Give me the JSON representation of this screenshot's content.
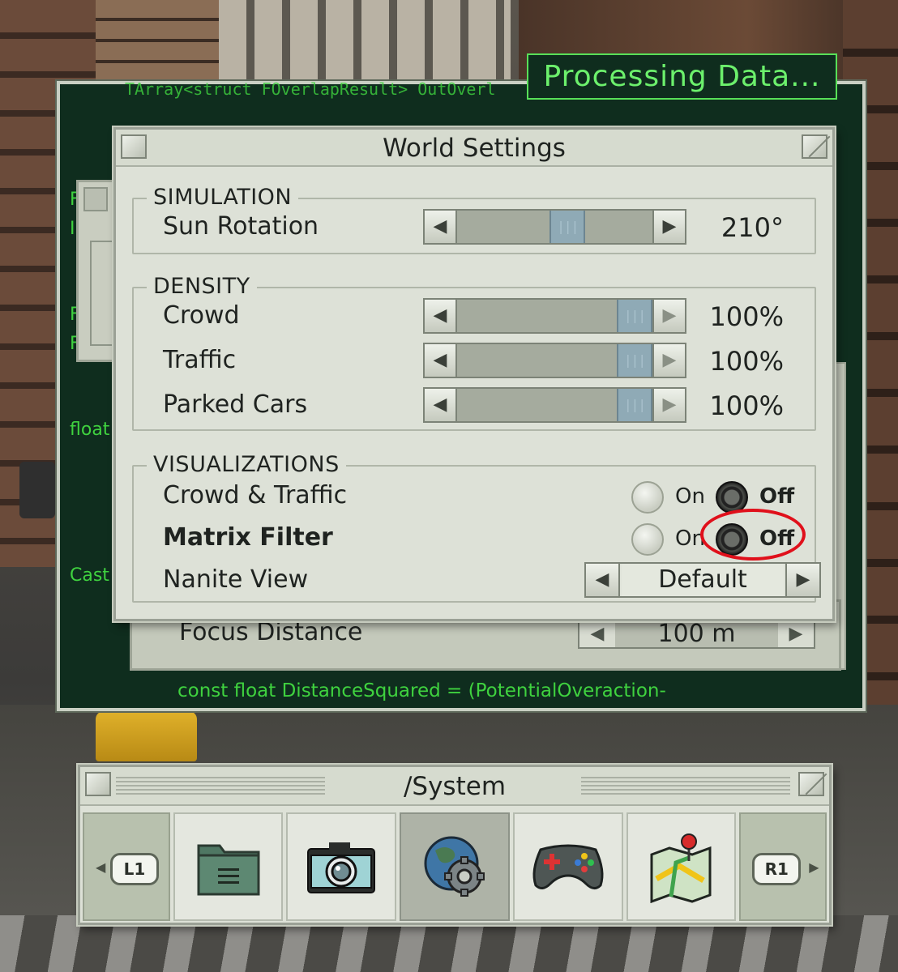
{
  "console": {
    "status_banner": "Processing Data...",
    "code_top": "TArray<struct FOverlapResult> OutOverl",
    "code_bottom": "const float DistanceSquared = (PotentialOveraction-",
    "fragments": [
      "F",
      "In",
      "F",
      "F",
      "float",
      "Cast"
    ],
    "behind_panel": {
      "focus_label": "Focus Distance",
      "focus_value": "100 m"
    }
  },
  "world_settings": {
    "title": "World Settings",
    "simulation": {
      "section_label": "SIMULATION",
      "sun_rotation": {
        "label": "Sun Rotation",
        "value": "210°",
        "level": 0.58
      }
    },
    "density": {
      "section_label": "DENSITY",
      "rows": [
        {
          "label": "Crowd",
          "value": "100%",
          "level": 1.0
        },
        {
          "label": "Traffic",
          "value": "100%",
          "level": 1.0
        },
        {
          "label": "Parked Cars",
          "value": "100%",
          "level": 1.0
        }
      ]
    },
    "visualizations": {
      "section_label": "VISUALIZATIONS",
      "crowd_traffic": {
        "label": "Crowd & Traffic",
        "on_label": "On",
        "off_label": "Off",
        "selected": "Off"
      },
      "matrix_filter": {
        "label": "Matrix Filter",
        "on_label": "On",
        "off_label": "Off",
        "selected": "Off"
      },
      "nanite_view": {
        "label": "Nanite View",
        "value": "Default"
      }
    }
  },
  "system": {
    "title": "/System",
    "left_shoulder": "L1",
    "right_shoulder": "R1",
    "tiles": [
      {
        "icon": "folder-icon",
        "active": false
      },
      {
        "icon": "camera-icon",
        "active": false
      },
      {
        "icon": "world-settings-icon",
        "active": true
      },
      {
        "icon": "gamepad-icon",
        "active": false
      },
      {
        "icon": "map-icon",
        "active": false
      }
    ]
  },
  "colors": {
    "console_bg": "#0f2d1e",
    "console_text": "#3fd23f",
    "panel_bg": "#dde1d7",
    "slider_thumb": "#8faab6",
    "highlight": "#e0101b"
  }
}
